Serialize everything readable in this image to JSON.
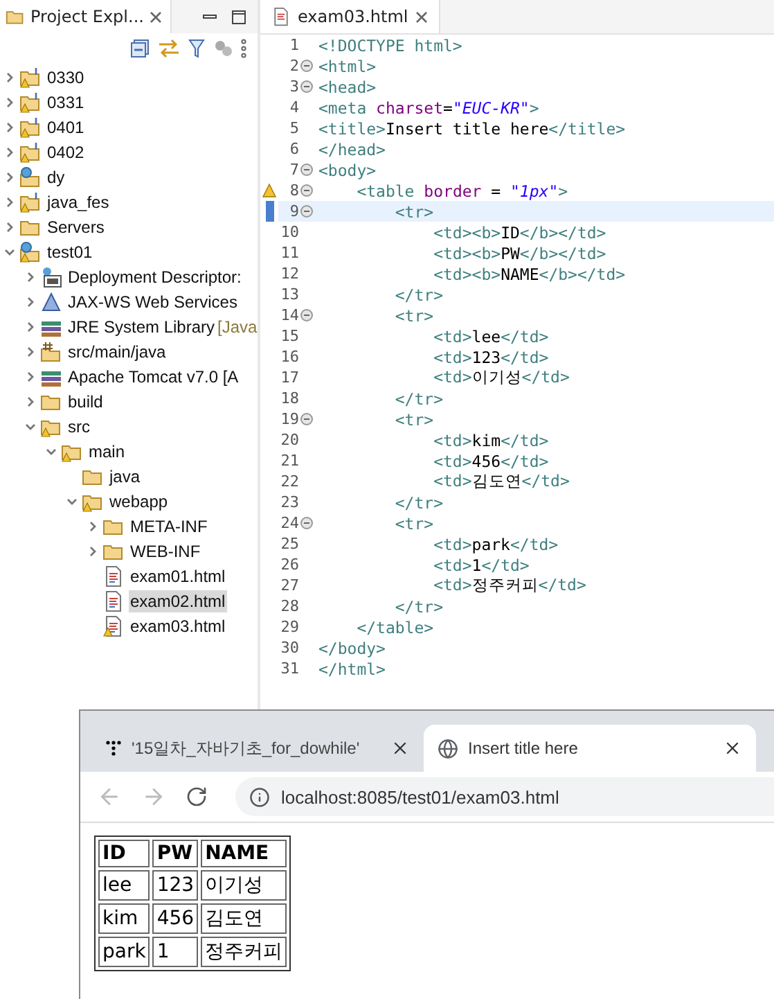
{
  "explorer": {
    "title": "Project Expl...",
    "tree": [
      {
        "label": "0330",
        "kind": "project",
        "warning": true,
        "expanded": false,
        "selected": false
      },
      {
        "label": "0331",
        "kind": "project",
        "warning": true,
        "expanded": false,
        "selected": false
      },
      {
        "label": "0401",
        "kind": "project",
        "warning": true,
        "expanded": false,
        "selected": false
      },
      {
        "label": "0402",
        "kind": "project",
        "warning": true,
        "expanded": false,
        "selected": false
      },
      {
        "label": "dy",
        "kind": "webproject",
        "warning": false,
        "expanded": false,
        "selected": false
      },
      {
        "label": "java_fes",
        "kind": "project",
        "warning": true,
        "expanded": false,
        "selected": false
      },
      {
        "label": "Servers",
        "kind": "folder",
        "warning": false,
        "expanded": false,
        "selected": false
      },
      {
        "label": "test01",
        "kind": "webproject",
        "warning": true,
        "expanded": true,
        "selected": false,
        "children": [
          {
            "label": "Deployment Descriptor:",
            "kind": "descriptor",
            "warning": false,
            "expanded": false,
            "selected": false
          },
          {
            "label": "JAX-WS Web Services",
            "kind": "webservices",
            "warning": false,
            "expanded": false,
            "selected": false
          },
          {
            "label": "JRE System Library",
            "suffix": "[Java",
            "kind": "library",
            "warning": false,
            "expanded": false,
            "selected": false
          },
          {
            "label": "src/main/java",
            "kind": "source",
            "warning": false,
            "expanded": false,
            "selected": false
          },
          {
            "label": "Apache Tomcat v7.0 [A",
            "kind": "library",
            "warning": false,
            "expanded": false,
            "selected": false
          },
          {
            "label": "build",
            "kind": "folder",
            "warning": false,
            "expanded": false,
            "selected": false
          },
          {
            "label": "src",
            "kind": "folder",
            "warning": true,
            "expanded": true,
            "selected": false,
            "children": [
              {
                "label": "main",
                "kind": "folder",
                "warning": true,
                "expanded": true,
                "selected": false,
                "children": [
                  {
                    "label": "java",
                    "kind": "folder",
                    "warning": false,
                    "selected": false
                  },
                  {
                    "label": "webapp",
                    "kind": "folder",
                    "warning": true,
                    "expanded": true,
                    "selected": false,
                    "children": [
                      {
                        "label": "META-INF",
                        "kind": "folder",
                        "warning": false,
                        "expanded": false,
                        "selected": false
                      },
                      {
                        "label": "WEB-INF",
                        "kind": "folder",
                        "warning": false,
                        "expanded": false,
                        "selected": false
                      },
                      {
                        "label": "exam01.html",
                        "kind": "file",
                        "warning": false,
                        "selected": false
                      },
                      {
                        "label": "exam02.html",
                        "kind": "file",
                        "warning": false,
                        "selected": true
                      },
                      {
                        "label": "exam03.html",
                        "kind": "file",
                        "warning": true,
                        "selected": false
                      }
                    ]
                  }
                ]
              }
            ]
          }
        ]
      }
    ]
  },
  "editor": {
    "tab": {
      "title": "exam03.html"
    },
    "lines": [
      {
        "number": "1",
        "fold": false,
        "warning": false,
        "current": false,
        "tokens": [
          {
            "kind": "tag",
            "text": "<!DOCTYPE html>"
          }
        ]
      },
      {
        "number": "2",
        "fold": true,
        "warning": false,
        "current": false,
        "tokens": [
          {
            "kind": "tag",
            "text": "<html>"
          }
        ]
      },
      {
        "number": "3",
        "fold": true,
        "warning": false,
        "current": false,
        "tokens": [
          {
            "kind": "tag",
            "text": "<head>"
          }
        ]
      },
      {
        "number": "4",
        "fold": false,
        "warning": false,
        "current": false,
        "tokens": [
          {
            "kind": "tag",
            "text": "<meta "
          },
          {
            "kind": "attr",
            "text": "charset"
          },
          {
            "kind": "plain",
            "text": "="
          },
          {
            "kind": "value",
            "text": "\"EUC-KR\""
          },
          {
            "kind": "tag",
            "text": ">"
          }
        ]
      },
      {
        "number": "5",
        "fold": false,
        "warning": false,
        "current": false,
        "tokens": [
          {
            "kind": "tag",
            "text": "<title>"
          },
          {
            "kind": "plain",
            "text": "Insert title here"
          },
          {
            "kind": "tag",
            "text": "</title>"
          }
        ]
      },
      {
        "number": "6",
        "fold": false,
        "warning": false,
        "current": false,
        "tokens": [
          {
            "kind": "tag",
            "text": "</head>"
          }
        ]
      },
      {
        "number": "7",
        "fold": true,
        "warning": false,
        "current": false,
        "tokens": [
          {
            "kind": "tag",
            "text": "<body>"
          }
        ]
      },
      {
        "number": "8",
        "fold": true,
        "warning": true,
        "current": false,
        "tokens": [
          {
            "kind": "tag",
            "text": "    <table "
          },
          {
            "kind": "attr",
            "text": "border"
          },
          {
            "kind": "plain",
            "text": " = "
          },
          {
            "kind": "value",
            "text": "\"1px\""
          },
          {
            "kind": "tag",
            "text": ">"
          }
        ]
      },
      {
        "number": "9",
        "fold": true,
        "warning": false,
        "current": true,
        "tokens": [
          {
            "kind": "tag",
            "text": "        <tr>"
          }
        ]
      },
      {
        "number": "10",
        "fold": false,
        "warning": false,
        "current": false,
        "tokens": [
          {
            "kind": "tag",
            "text": "            <td><b>"
          },
          {
            "kind": "plain",
            "text": "ID"
          },
          {
            "kind": "tag",
            "text": "</b></td>"
          }
        ]
      },
      {
        "number": "11",
        "fold": false,
        "warning": false,
        "current": false,
        "tokens": [
          {
            "kind": "tag",
            "text": "            <td><b>"
          },
          {
            "kind": "plain",
            "text": "PW"
          },
          {
            "kind": "tag",
            "text": "</b></td>"
          }
        ]
      },
      {
        "number": "12",
        "fold": false,
        "warning": false,
        "current": false,
        "tokens": [
          {
            "kind": "tag",
            "text": "            <td><b>"
          },
          {
            "kind": "plain",
            "text": "NAME"
          },
          {
            "kind": "tag",
            "text": "</b></td>"
          }
        ]
      },
      {
        "number": "13",
        "fold": false,
        "warning": false,
        "current": false,
        "tokens": [
          {
            "kind": "tag",
            "text": "        </tr>"
          }
        ]
      },
      {
        "number": "14",
        "fold": true,
        "warning": false,
        "current": false,
        "tokens": [
          {
            "kind": "tag",
            "text": "        <tr>"
          }
        ]
      },
      {
        "number": "15",
        "fold": false,
        "warning": false,
        "current": false,
        "tokens": [
          {
            "kind": "tag",
            "text": "            <td>"
          },
          {
            "kind": "plain",
            "text": "lee"
          },
          {
            "kind": "tag",
            "text": "</td>"
          }
        ]
      },
      {
        "number": "16",
        "fold": false,
        "warning": false,
        "current": false,
        "tokens": [
          {
            "kind": "tag",
            "text": "            <td>"
          },
          {
            "kind": "plain",
            "text": "123"
          },
          {
            "kind": "tag",
            "text": "</td>"
          }
        ]
      },
      {
        "number": "17",
        "fold": false,
        "warning": false,
        "current": false,
        "tokens": [
          {
            "kind": "tag",
            "text": "            <td>"
          },
          {
            "kind": "plain",
            "text": "이기성"
          },
          {
            "kind": "tag",
            "text": "</td>"
          }
        ]
      },
      {
        "number": "18",
        "fold": false,
        "warning": false,
        "current": false,
        "tokens": [
          {
            "kind": "tag",
            "text": "        </tr>"
          }
        ]
      },
      {
        "number": "19",
        "fold": true,
        "warning": false,
        "current": false,
        "tokens": [
          {
            "kind": "tag",
            "text": "        <tr>"
          }
        ]
      },
      {
        "number": "20",
        "fold": false,
        "warning": false,
        "current": false,
        "tokens": [
          {
            "kind": "tag",
            "text": "            <td>"
          },
          {
            "kind": "plain",
            "text": "kim"
          },
          {
            "kind": "tag",
            "text": "</td>"
          }
        ]
      },
      {
        "number": "21",
        "fold": false,
        "warning": false,
        "current": false,
        "tokens": [
          {
            "kind": "tag",
            "text": "            <td>"
          },
          {
            "kind": "plain",
            "text": "456"
          },
          {
            "kind": "tag",
            "text": "</td>"
          }
        ]
      },
      {
        "number": "22",
        "fold": false,
        "warning": false,
        "current": false,
        "tokens": [
          {
            "kind": "tag",
            "text": "            <td>"
          },
          {
            "kind": "plain",
            "text": "김도연"
          },
          {
            "kind": "tag",
            "text": "</td>"
          }
        ]
      },
      {
        "number": "23",
        "fold": false,
        "warning": false,
        "current": false,
        "tokens": [
          {
            "kind": "tag",
            "text": "        </tr>"
          }
        ]
      },
      {
        "number": "24",
        "fold": true,
        "warning": false,
        "current": false,
        "tokens": [
          {
            "kind": "tag",
            "text": "        <tr>"
          }
        ]
      },
      {
        "number": "25",
        "fold": false,
        "warning": false,
        "current": false,
        "tokens": [
          {
            "kind": "tag",
            "text": "            <td>"
          },
          {
            "kind": "plain",
            "text": "park"
          },
          {
            "kind": "tag",
            "text": "</td>"
          }
        ]
      },
      {
        "number": "26",
        "fold": false,
        "warning": false,
        "current": false,
        "tokens": [
          {
            "kind": "tag",
            "text": "            <td>"
          },
          {
            "kind": "plain",
            "text": "1"
          },
          {
            "kind": "tag",
            "text": "</td>"
          }
        ]
      },
      {
        "number": "27",
        "fold": false,
        "warning": false,
        "current": false,
        "tokens": [
          {
            "kind": "tag",
            "text": "            <td>"
          },
          {
            "kind": "plain",
            "text": "정주커피"
          },
          {
            "kind": "tag",
            "text": "</td>"
          }
        ]
      },
      {
        "number": "28",
        "fold": false,
        "warning": false,
        "current": false,
        "tokens": [
          {
            "kind": "tag",
            "text": "        </tr>"
          }
        ]
      },
      {
        "number": "29",
        "fold": false,
        "warning": false,
        "current": false,
        "tokens": [
          {
            "kind": "tag",
            "text": "    </table>"
          }
        ]
      },
      {
        "number": "30",
        "fold": false,
        "warning": false,
        "current": false,
        "tokens": [
          {
            "kind": "tag",
            "text": "</body>"
          }
        ]
      },
      {
        "number": "31",
        "fold": false,
        "warning": false,
        "current": false,
        "tokens": [
          {
            "kind": "tag",
            "text": "</html>"
          }
        ]
      }
    ]
  },
  "browser": {
    "tabs": [
      {
        "title": "'15일차_자바기초_for_dowhile'",
        "kind": "blog",
        "selected": false
      },
      {
        "title": "Insert title here",
        "kind": "globe",
        "selected": true
      }
    ],
    "url": "localhost:8085/test01/exam03.html",
    "table": {
      "columns": [
        "ID",
        "PW",
        "NAME"
      ],
      "rows": [
        [
          "lee",
          "123",
          "이기성"
        ],
        [
          "kim",
          "456",
          "김도연"
        ],
        [
          "park",
          "1",
          "정주커피"
        ]
      ]
    }
  }
}
